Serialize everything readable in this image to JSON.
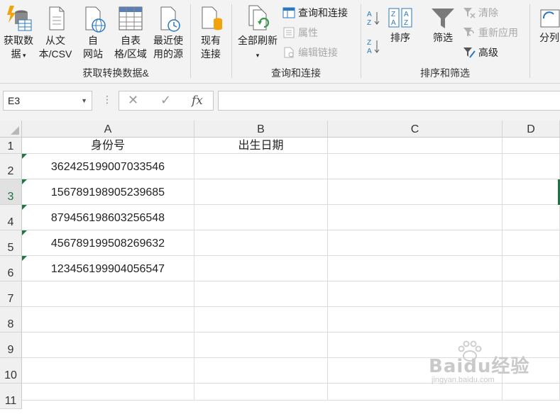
{
  "ribbon": {
    "get_data": {
      "label": "获取数\n据"
    },
    "from_text": {
      "label": "从文\n本/CSV"
    },
    "from_web": {
      "label": "自\n网站"
    },
    "from_table": {
      "label": "自表\n格/区域"
    },
    "recent_sources": {
      "label": "最近使\n用的源"
    },
    "existing_conn": {
      "label": "现有\n连接"
    },
    "group_get": "获取转换数据&",
    "refresh_all": {
      "label": "全部刷新"
    },
    "queries_conn": "查询和连接",
    "properties": "属性",
    "edit_links": "编辑链接",
    "group_queries": "查询和连接",
    "sort": "排序",
    "filter": "筛选",
    "clear": "清除",
    "reapply": "重新应用",
    "advanced": "高级",
    "group_sort": "排序和筛选",
    "text_to_cols": "分列"
  },
  "formula_bar": {
    "name_box": "E3",
    "cancel_glyph": "✕",
    "enter_glyph": "✓",
    "fx_glyph": "fx",
    "content": ""
  },
  "sheet": {
    "columns": [
      "A",
      "B",
      "C",
      "D"
    ],
    "rows": [
      "1",
      "2",
      "3",
      "4",
      "5",
      "6",
      "7",
      "8",
      "9",
      "10",
      "11"
    ],
    "header_a": "身份号",
    "header_b": "出生日期",
    "ids": [
      "362425199007033546",
      "156789198905239685",
      "879456198603256548",
      "456789199508269632",
      "123456199904056547"
    ],
    "selected_cell": "E3"
  },
  "watermark": {
    "brand": "Baidu经验",
    "url": "jingyan.baidu.com"
  },
  "colors": {
    "accent": "#1e7145",
    "error_triangle": "#1f7a3a"
  }
}
